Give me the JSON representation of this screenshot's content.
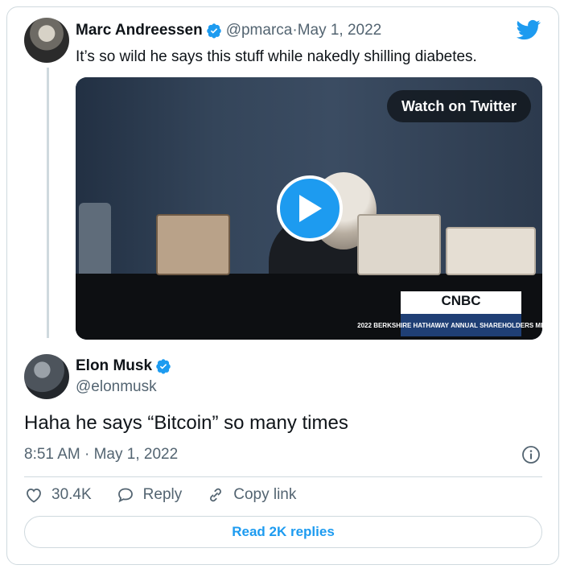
{
  "parent_tweet": {
    "author_name": "Marc Andreessen",
    "handle": "@pmarca",
    "separator": " · ",
    "date": "May 1, 2022",
    "text": "It’s so wild he says this stuff while nakedly shilling diabetes.",
    "video": {
      "watch_label": "Watch on Twitter",
      "broadcaster": "CNBC",
      "event_year": "2022",
      "event_name": "BERKSHIRE HATHAWAY",
      "event_subtitle": "ANNUAL SHAREHOLDERS MEETING"
    }
  },
  "main_tweet": {
    "author_name": "Elon Musk",
    "handle": "@elonmusk",
    "text": "Haha he says “Bitcoin” so many times",
    "time": "8:51 AM",
    "separator": " · ",
    "date": "May 1, 2022"
  },
  "actions": {
    "like_count": "30.4K",
    "reply_label": "Reply",
    "copy_link_label": "Copy link"
  },
  "read_replies_label": "Read 2K replies",
  "colors": {
    "accent": "#1d9bf0",
    "text_primary": "#0f1419",
    "text_secondary": "#536471",
    "border": "#cfd9de"
  },
  "icons": {
    "brand": "twitter-bird-icon",
    "verified": "verified-badge-icon",
    "info": "info-icon",
    "like": "heart-icon",
    "reply": "speech-bubble-icon",
    "copy_link": "link-icon",
    "play": "play-icon"
  }
}
